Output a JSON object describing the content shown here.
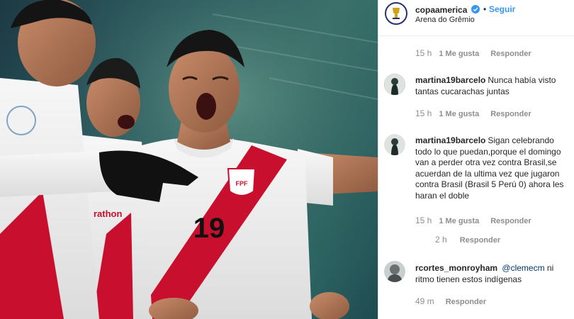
{
  "post": {
    "username": "copaamerica",
    "separator": "•",
    "follow_label": "Seguir",
    "location": "Arena do Grêmio",
    "jersey_number": "19",
    "crest_text": "FPF",
    "sponsor_fragment": "rathon"
  },
  "top_meta": {
    "time": "15 h",
    "likes": "1 Me gusta",
    "reply": "Responder"
  },
  "comments": [
    {
      "username": "martina19barcelo",
      "text": "Nunca había visto tantas cucarachas juntas",
      "time": "15 h",
      "likes": "1 Me gusta",
      "reply": "Responder"
    },
    {
      "username": "martina19barcelo",
      "text": "Sigan celebrando todo lo que puedan,porque el domingo van a perder otra vez contra Brasil,se acuerdan de la ultima vez que jugaron contra Brasil (Brasil 5 Perú 0) ahora les haran el doble",
      "time": "15 h",
      "likes": "1 Me gusta",
      "reply": "Responder"
    },
    {
      "partial_meta_time": "2 h",
      "reply": "Responder"
    },
    {
      "username": "rcortes_monroyham",
      "mention": "@clemecm",
      "text": "ni ritmo tienen estos indígenas",
      "time": "49 m",
      "reply": "Responder"
    }
  ],
  "colors": {
    "follow": "#3897f0",
    "verified": "#3897f0",
    "meta": "#8e8e8e",
    "text": "#262626",
    "jersey_red": "#c8102e"
  }
}
